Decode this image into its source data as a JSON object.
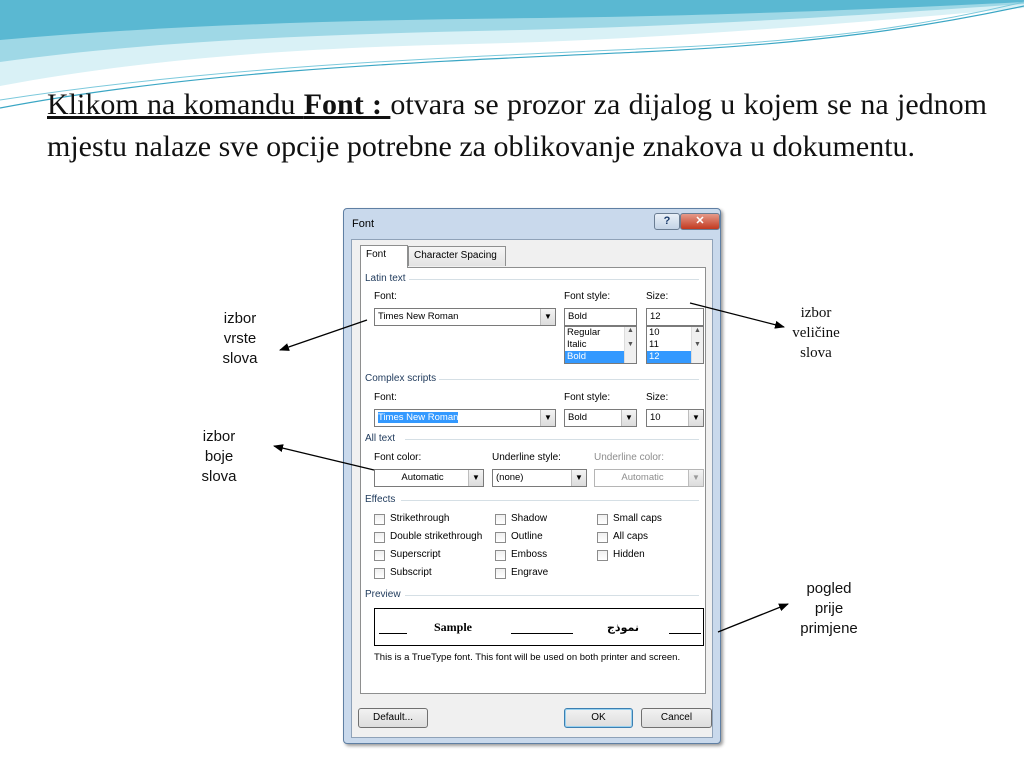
{
  "slide": {
    "intro": "Klikom na komandu ",
    "command": "Font : ",
    "rest": "otvara se prozor za dijalog u kojem se na jednom mjestu nalaze sve opcije potrebne za oblikovanje znakova u dokumentu."
  },
  "dialog": {
    "title": "Font",
    "help_label": "?",
    "close_label": "✕",
    "tabs": [
      "Font",
      "Character Spacing"
    ],
    "latin": {
      "group_label": "Latin text",
      "font_label": "Font:",
      "font_value": "Times New Roman",
      "style_label": "Font style:",
      "style_value": "Bold",
      "style_options": [
        "Regular",
        "Italic",
        "Bold"
      ],
      "style_selected": "Bold",
      "size_label": "Size:",
      "size_value": "12",
      "size_options": [
        "10",
        "11",
        "12"
      ],
      "size_selected": "12"
    },
    "complex": {
      "group_label": "Complex scripts",
      "font_label": "Font:",
      "font_value": "Times New Roman",
      "style_label": "Font style:",
      "style_value": "Bold",
      "size_label": "Size:",
      "size_value": "10"
    },
    "all_text": {
      "group_label": "All text",
      "color_label": "Font color:",
      "color_value": "Automatic",
      "underline_label": "Underline style:",
      "underline_value": "(none)",
      "underline_color_label": "Underline color:",
      "underline_color_value": "Automatic"
    },
    "effects": {
      "group_label": "Effects",
      "col1": [
        "Strikethrough",
        "Double strikethrough",
        "Superscript",
        "Subscript"
      ],
      "col2": [
        "Shadow",
        "Outline",
        "Emboss",
        "Engrave"
      ],
      "col3": [
        "Small caps",
        "All caps",
        "Hidden"
      ]
    },
    "preview": {
      "group_label": "Preview",
      "sample": "Sample",
      "arabic_sample": "نموذج",
      "note": "This is a TrueType font. This font will be used on both printer and screen."
    },
    "buttons": {
      "default": "Default...",
      "ok": "OK",
      "cancel": "Cancel"
    }
  },
  "callouts": {
    "font_type": [
      "izbor",
      "vrste",
      "slova"
    ],
    "font_color": [
      "izbor",
      "boje",
      "slova"
    ],
    "font_size": [
      "izbor",
      "veličine",
      "slova"
    ],
    "preview": [
      "pogled",
      "prije",
      "primjene"
    ]
  },
  "colors": {
    "selection": "#3399ff",
    "wave_light": "#bfe6ef",
    "wave_dark": "#3aa6c4"
  }
}
